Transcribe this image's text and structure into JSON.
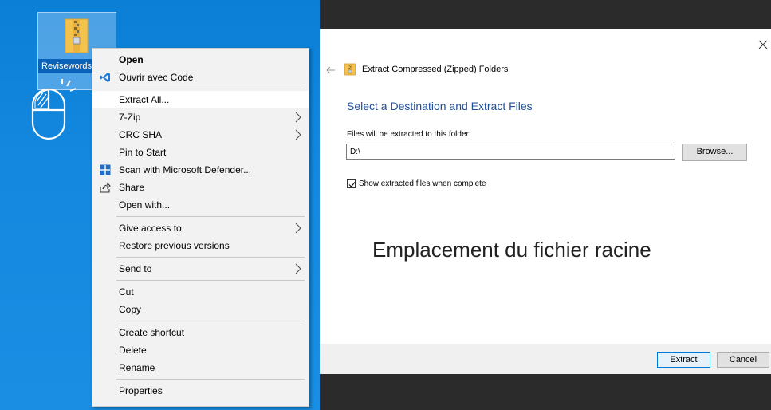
{
  "desktop": {
    "icon_label": "Revisewords"
  },
  "context_menu": {
    "items": [
      {
        "label": "Open",
        "bold": true
      },
      {
        "label": "Ouvrir avec Code",
        "icon": "vscode-icon"
      },
      {
        "label": "Extract All...",
        "highlighted": true
      },
      {
        "label": "7-Zip",
        "submenu": true
      },
      {
        "label": "CRC SHA",
        "submenu": true
      },
      {
        "label": "Pin to Start"
      },
      {
        "label": "Scan with Microsoft Defender...",
        "icon": "defender-shield-icon"
      },
      {
        "label": "Share",
        "icon": "share-icon"
      },
      {
        "label": "Open with..."
      },
      {
        "label": "Give access to",
        "submenu": true
      },
      {
        "label": "Restore previous versions"
      },
      {
        "label": "Send to",
        "submenu": true
      },
      {
        "label": "Cut"
      },
      {
        "label": "Copy"
      },
      {
        "label": "Create shortcut"
      },
      {
        "label": "Delete"
      },
      {
        "label": "Rename"
      },
      {
        "label": "Properties"
      }
    ]
  },
  "dialog": {
    "title": "Extract Compressed (Zipped) Folders",
    "heading": "Select a Destination and Extract Files",
    "field_label": "Files will be extracted to this folder:",
    "path_value": "D:\\",
    "browse_label": "Browse...",
    "checkbox_label": "Show extracted files when complete",
    "checkbox_checked": true,
    "extract_label": "Extract",
    "cancel_label": "Cancel"
  },
  "annotation": {
    "text": "Emplacement du fichier racine"
  },
  "colors": {
    "desktop_blue": "#1488de",
    "heading_blue": "#1f4e9b",
    "accent_button_border": "#0078d7"
  }
}
